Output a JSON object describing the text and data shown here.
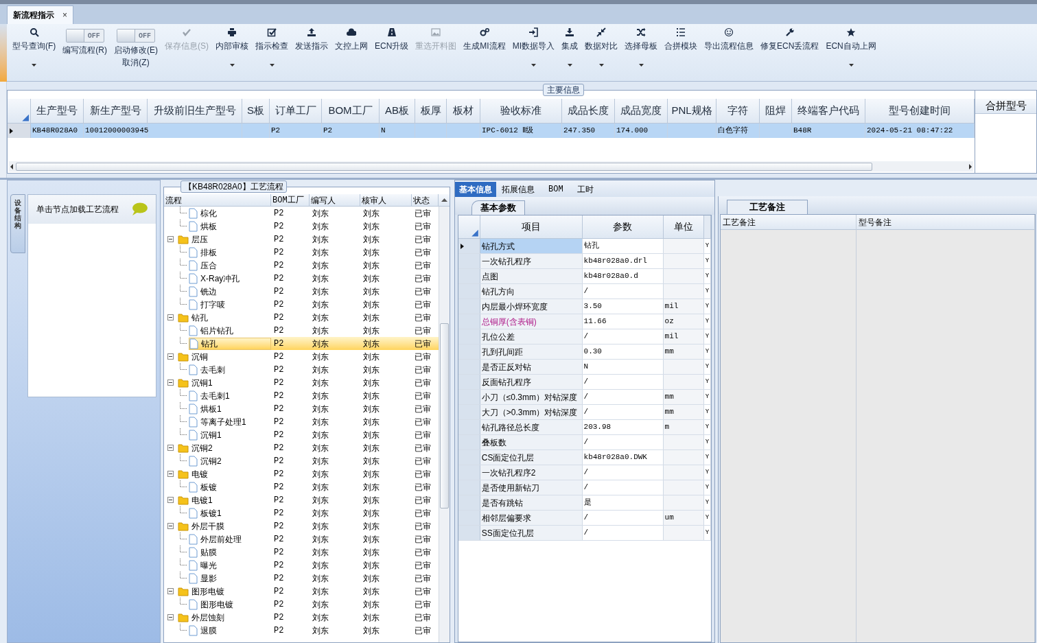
{
  "tab": {
    "title": "新流程指示",
    "close": "×"
  },
  "toolbar": [
    {
      "kind": "button",
      "label": "型号查询(F)",
      "disabled": false,
      "dropdown": true
    },
    {
      "kind": "toggle",
      "label": "编写流程(R)",
      "switch_text": "OFF",
      "on": false,
      "dropdown": false
    },
    {
      "kind": "toggle",
      "label": "启动修改(E)",
      "label_2": "取消(Z)",
      "switch_text": "OFF",
      "on": false,
      "dropdown": false
    },
    {
      "kind": "button",
      "label": "保存信息(S)",
      "disabled": true,
      "dropdown": false
    },
    {
      "kind": "button",
      "label": "内部审核",
      "disabled": false,
      "dropdown": true
    },
    {
      "kind": "button",
      "label": "指示检查",
      "disabled": false,
      "dropdown": true
    },
    {
      "kind": "button",
      "label": "发送指示",
      "disabled": false,
      "dropdown": false
    },
    {
      "kind": "button",
      "label": "文控上网",
      "disabled": false,
      "dropdown": false
    },
    {
      "kind": "button",
      "label": "ECN升级",
      "disabled": false,
      "dropdown": false
    },
    {
      "kind": "button",
      "label": "重选开料图",
      "disabled": true,
      "dropdown": false
    },
    {
      "kind": "button",
      "label": "生成MI流程",
      "disabled": false,
      "dropdown": false
    },
    {
      "kind": "button",
      "label": "MI数据导入",
      "disabled": false,
      "dropdown": true
    },
    {
      "kind": "button",
      "label": "集成",
      "disabled": false,
      "dropdown": true
    },
    {
      "kind": "button",
      "label": "数据对比",
      "disabled": false,
      "dropdown": true
    },
    {
      "kind": "button",
      "label": "选择母板",
      "disabled": false,
      "dropdown": true
    },
    {
      "kind": "button",
      "label": "合拼模块",
      "disabled": false,
      "dropdown": false
    },
    {
      "kind": "button",
      "label": "导出流程信息",
      "disabled": false,
      "dropdown": false
    },
    {
      "kind": "button",
      "label": "修复ECN丢流程",
      "disabled": false,
      "dropdown": false
    },
    {
      "kind": "button",
      "label": "ECN自动上网",
      "disabled": false,
      "dropdown": true
    }
  ],
  "main_info": {
    "title": "主要信息",
    "side_column": "合拼型号",
    "columns": [
      "生产型号",
      "新生产型号",
      "升级前旧生产型号",
      "S板",
      "订单工厂",
      "BOM工厂",
      "AB板",
      "板厚",
      "板材",
      "验收标准",
      "成品长度",
      "成品宽度",
      "PNL规格",
      "字符",
      "阻焊",
      "终端客户代码",
      "型号创建时间"
    ],
    "rows": [
      {
        "selected": true,
        "cells": [
          "KB48R028A0",
          "10012000003945",
          null,
          null,
          "P2",
          "P2",
          "N",
          null,
          null,
          "IPC-6012 Ⅱ级",
          "247.350",
          "174.000",
          null,
          "白色字符",
          null,
          "B48R",
          "2024-05-21 08:47:22"
        ]
      }
    ]
  },
  "left_panel": {
    "vertical_tab": "设备结构",
    "hint": "单击节点加载工艺流程"
  },
  "process": {
    "title": "【KB48R028A0】工艺流程",
    "columns": [
      "流程",
      "BOM工厂",
      "编写人",
      "核审人",
      "状态"
    ],
    "tree": [
      {
        "children": [
          {
            "label": "棕化",
            "bom": "P2",
            "writer": "刘东",
            "reviewer": "刘东",
            "status": "已审",
            "selected": false
          },
          {
            "label": "烘板",
            "bom": "P2",
            "writer": "刘东",
            "reviewer": "刘东",
            "status": "已审",
            "selected": false
          }
        ]
      },
      {
        "label": "层压",
        "bom": "P2",
        "writer": "刘东",
        "reviewer": "刘东",
        "status": "已审",
        "selected": false,
        "expanded": true,
        "children": [
          {
            "label": "排板",
            "bom": "P2",
            "writer": "刘东",
            "reviewer": "刘东",
            "status": "已审",
            "selected": false
          },
          {
            "label": "压合",
            "bom": "P2",
            "writer": "刘东",
            "reviewer": "刘东",
            "status": "已审",
            "selected": false
          },
          {
            "label": "X-Ray冲孔",
            "bom": "P2",
            "writer": "刘东",
            "reviewer": "刘东",
            "status": "已审",
            "selected": false
          },
          {
            "label": "铣边",
            "bom": "P2",
            "writer": "刘东",
            "reviewer": "刘东",
            "status": "已审",
            "selected": false
          },
          {
            "label": "打字唛",
            "bom": "P2",
            "writer": "刘东",
            "reviewer": "刘东",
            "status": "已审",
            "selected": false
          }
        ]
      },
      {
        "label": "钻孔",
        "bom": "P2",
        "writer": "刘东",
        "reviewer": "刘东",
        "status": "已审",
        "selected": false,
        "expanded": true,
        "children": [
          {
            "label": "铝片钻孔",
            "bom": "P2",
            "writer": "刘东",
            "reviewer": "刘东",
            "status": "已审",
            "selected": false
          },
          {
            "label": "钻孔",
            "bom": "P2",
            "writer": "刘东",
            "reviewer": "刘东",
            "status": "已审",
            "selected": true
          }
        ]
      },
      {
        "label": "沉铜",
        "bom": "P2",
        "writer": "刘东",
        "reviewer": "刘东",
        "status": "已审",
        "selected": false,
        "expanded": true,
        "children": [
          {
            "label": "去毛刺",
            "bom": "P2",
            "writer": "刘东",
            "reviewer": "刘东",
            "status": "已审",
            "selected": false
          }
        ]
      },
      {
        "label": "沉铜1",
        "bom": "P2",
        "writer": "刘东",
        "reviewer": "刘东",
        "status": "已审",
        "selected": false,
        "expanded": true,
        "children": [
          {
            "label": "去毛刺1",
            "bom": "P2",
            "writer": "刘东",
            "reviewer": "刘东",
            "status": "已审",
            "selected": false
          },
          {
            "label": "烘板1",
            "bom": "P2",
            "writer": "刘东",
            "reviewer": "刘东",
            "status": "已审",
            "selected": false
          },
          {
            "label": "等离子处理1",
            "bom": "P2",
            "writer": "刘东",
            "reviewer": "刘东",
            "status": "已审",
            "selected": false
          },
          {
            "label": "沉铜1",
            "bom": "P2",
            "writer": "刘东",
            "reviewer": "刘东",
            "status": "已审",
            "selected": false
          }
        ]
      },
      {
        "label": "沉铜2",
        "bom": "P2",
        "writer": "刘东",
        "reviewer": "刘东",
        "status": "已审",
        "selected": false,
        "expanded": true,
        "children": [
          {
            "label": "沉铜2",
            "bom": "P2",
            "writer": "刘东",
            "reviewer": "刘东",
            "status": "已审",
            "selected": false
          }
        ]
      },
      {
        "label": "电镀",
        "bom": "P2",
        "writer": "刘东",
        "reviewer": "刘东",
        "status": "已审",
        "selected": false,
        "expanded": true,
        "children": [
          {
            "label": "板镀",
            "bom": "P2",
            "writer": "刘东",
            "reviewer": "刘东",
            "status": "已审",
            "selected": false
          }
        ]
      },
      {
        "label": "电镀1",
        "bom": "P2",
        "writer": "刘东",
        "reviewer": "刘东",
        "status": "已审",
        "selected": false,
        "expanded": true,
        "children": [
          {
            "label": "板镀1",
            "bom": "P2",
            "writer": "刘东",
            "reviewer": "刘东",
            "status": "已审",
            "selected": false
          }
        ]
      },
      {
        "label": "外层干膜",
        "bom": "P2",
        "writer": "刘东",
        "reviewer": "刘东",
        "status": "已审",
        "selected": false,
        "expanded": true,
        "children": [
          {
            "label": "外层前处理",
            "bom": "P2",
            "writer": "刘东",
            "reviewer": "刘东",
            "status": "已审",
            "selected": false
          },
          {
            "label": "贴膜",
            "bom": "P2",
            "writer": "刘东",
            "reviewer": "刘东",
            "status": "已审",
            "selected": false
          },
          {
            "label": "曝光",
            "bom": "P2",
            "writer": "刘东",
            "reviewer": "刘东",
            "status": "已审",
            "selected": false
          },
          {
            "label": "显影",
            "bom": "P2",
            "writer": "刘东",
            "reviewer": "刘东",
            "status": "已审",
            "selected": false
          }
        ]
      },
      {
        "label": "图形电镀",
        "bom": "P2",
        "writer": "刘东",
        "reviewer": "刘东",
        "status": "已审",
        "selected": false,
        "expanded": true,
        "children": [
          {
            "label": "图形电镀",
            "bom": "P2",
            "writer": "刘东",
            "reviewer": "刘东",
            "status": "已审",
            "selected": false
          }
        ]
      },
      {
        "label": "外层蚀刻",
        "bom": "P2",
        "writer": "刘东",
        "reviewer": "刘东",
        "status": "已审",
        "selected": false,
        "expanded": true,
        "children": [
          {
            "label": "退膜",
            "bom": "P2",
            "writer": "刘东",
            "reviewer": "刘东",
            "status": "已审",
            "selected": false
          }
        ]
      }
    ]
  },
  "detail": {
    "tabs": [
      {
        "label": "基本信息",
        "selected": true
      },
      {
        "label": "拓展信息",
        "selected": false
      },
      {
        "label": "BOM",
        "selected": false
      },
      {
        "label": "工时",
        "selected": false
      }
    ],
    "subtab": "基本参数",
    "columns": [
      "项目",
      "参数",
      "单位"
    ],
    "rows": [
      {
        "item": "钻孔方式",
        "value": "钻孔",
        "unit": null,
        "column_4": "Y",
        "selected": true,
        "flagged": false
      },
      {
        "item": "一次钻孔程序",
        "value": "kb48r028a0.drl",
        "unit": null,
        "column_4": "Y",
        "selected": false,
        "flagged": false
      },
      {
        "item": "点图",
        "value": "kb48r028a0.d",
        "unit": null,
        "column_4": "Y",
        "selected": false,
        "flagged": false
      },
      {
        "item": "钻孔方向",
        "value": "/",
        "unit": null,
        "column_4": "Y",
        "selected": false,
        "flagged": false
      },
      {
        "item": "内层最小焊环宽度",
        "value": "3.50",
        "unit": "mil",
        "column_4": "Y",
        "selected": false,
        "flagged": false
      },
      {
        "item": "总铜厚(含表铜)",
        "value": "11.66",
        "unit": "oz",
        "column_4": "Y",
        "selected": false,
        "flagged": true
      },
      {
        "item": "孔位公差",
        "value": "/",
        "unit": "mil",
        "column_4": "Y",
        "selected": false,
        "flagged": false
      },
      {
        "item": "孔到孔间距",
        "value": "0.30",
        "unit": "mm",
        "column_4": "Y",
        "selected": false,
        "flagged": false
      },
      {
        "item": "是否正反对钻",
        "value": "N",
        "unit": null,
        "column_4": "Y",
        "selected": false,
        "flagged": false
      },
      {
        "item": "反面钻孔程序",
        "value": "/",
        "unit": null,
        "column_4": "Y",
        "selected": false,
        "flagged": false
      },
      {
        "item": "小刀（≤0.3mm）对钻深度",
        "value": "/",
        "unit": "mm",
        "column_4": "Y",
        "selected": false,
        "flagged": false
      },
      {
        "item": "大刀（>0.3mm）对钻深度",
        "value": "/",
        "unit": "mm",
        "column_4": "Y",
        "selected": false,
        "flagged": false
      },
      {
        "item": "钻孔路径总长度",
        "value": "203.98",
        "unit": "m",
        "column_4": "Y",
        "selected": false,
        "flagged": false
      },
      {
        "item": "叠板数",
        "value": "/",
        "unit": null,
        "column_4": "Y",
        "selected": false,
        "flagged": false
      },
      {
        "item": "CS面定位孔层",
        "value": "kb48r028a0.DWK",
        "unit": null,
        "column_4": "Y",
        "selected": false,
        "flagged": false
      },
      {
        "item": "一次钻孔程序2",
        "value": "/",
        "unit": null,
        "column_4": "Y",
        "selected": false,
        "flagged": false
      },
      {
        "item": "是否使用新钻刀",
        "value": "/",
        "unit": null,
        "column_4": "Y",
        "selected": false,
        "flagged": false
      },
      {
        "item": "是否有跳钻",
        "value": "是",
        "unit": null,
        "column_4": "Y",
        "selected": false,
        "flagged": false
      },
      {
        "item": "相邻层偏要求",
        "value": "/",
        "unit": "um",
        "column_4": "Y",
        "selected": false,
        "flagged": false
      },
      {
        "item": "SS面定位孔层",
        "value": "/",
        "unit": null,
        "column_4": "Y",
        "selected": false,
        "flagged": false
      }
    ]
  },
  "notes": {
    "title": "工艺备注",
    "columns": [
      "工艺备注",
      "型号备注"
    ]
  }
}
